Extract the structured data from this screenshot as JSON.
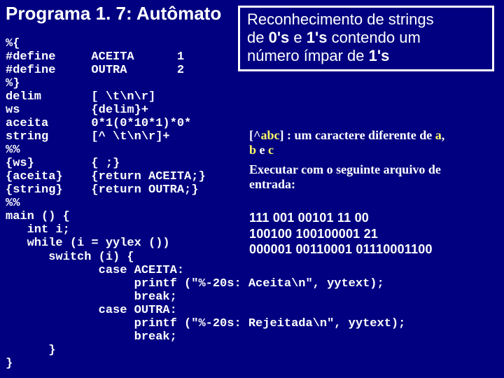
{
  "title": "Programa 1. 7:  Autômato",
  "code": "%{\n#define     ACEITA      1\n#define     OUTRA       2\n%}\ndelim       [ \\t\\n\\r]\nws          {delim}+\naceita      0*1(0*10*1)*0*\nstring      [^ \\t\\n\\r]+\n%%\n{ws}        { ;}\n{aceita}    {return ACEITA;}\n{string}    {return OUTRA;}\n%%\nmain () {\n   int i;\n   while (i = yylex ())\n      switch (i) {\n             case ACEITA:\n                  printf (\"%-20s: Aceita\\n\", yytext);\n                  break;\n             case OUTRA:\n                  printf (\"%-20s: Rejeitada\\n\", yytext);\n                  break;\n      }\n}",
  "box1_l1": "Reconhecimento de strings",
  "box1_l2a": "de ",
  "box1_l2b": "0's",
  "box1_l2c": " e ",
  "box1_l2d": "1's",
  "box1_l2e": " contendo um",
  "box1_l3a": "número ímpar de ",
  "box1_l3b": "1's",
  "regex_p1": "[^",
  "regex_p2": "abc",
  "regex_p3": "]",
  "regex_p4": " : um caractere diferente de ",
  "regex_p5": "a",
  "regex_p6": ",",
  "regex_l2a": "b",
  "regex_l2b": " e ",
  "regex_l2c": "c",
  "exec_l1": "Executar com o seguinte arquivo de",
  "exec_l2": "entrada:",
  "input_l1": "111 001  00101  11  00",
  "input_l2": "100100  100100001  21",
  "input_l3": "000001 00110001  01110001100"
}
